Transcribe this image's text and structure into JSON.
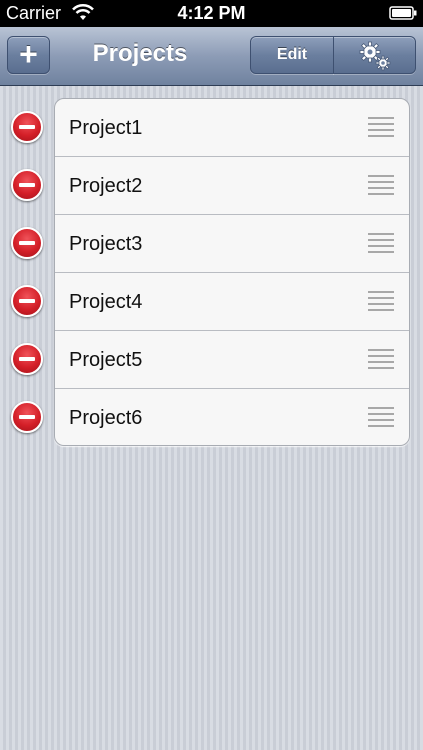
{
  "status_bar": {
    "carrier": "Carrier",
    "time": "4:12 PM",
    "wifi_icon": "wifi-icon",
    "battery_icon": "battery-icon"
  },
  "nav_bar": {
    "add_button_icon": "plus-icon",
    "add_glyph": "+",
    "title": "Projects",
    "edit_label": "Edit",
    "settings_icon": "gears-icon"
  },
  "projects": [
    {
      "name": "Project1"
    },
    {
      "name": "Project2"
    },
    {
      "name": "Project3"
    },
    {
      "name": "Project4"
    },
    {
      "name": "Project5"
    },
    {
      "name": "Project6"
    }
  ],
  "row_icons": {
    "delete": "delete-minus-icon",
    "reorder": "reorder-grip-icon"
  },
  "colors": {
    "delete_red": "#d41f28",
    "nav_bar_blue": "#8d9cb6",
    "background": "#cfd4dd"
  }
}
